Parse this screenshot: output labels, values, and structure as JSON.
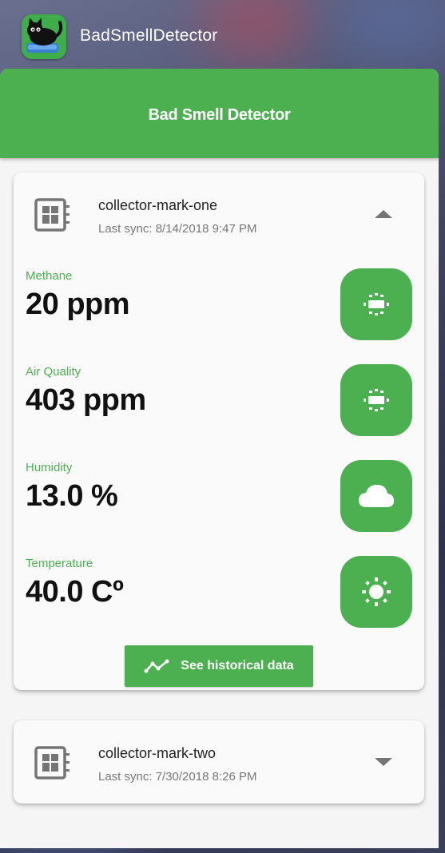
{
  "app": {
    "name": "BadSmellDetector"
  },
  "toolbar": {
    "title": "Bad Smell Detector"
  },
  "devices": [
    {
      "name": "collector-mark-one",
      "last_sync": "Last sync: 8/14/2018 9:47 PM",
      "expanded": true,
      "toggle_icon": "chevron-up-icon",
      "readings": [
        {
          "label": "Methane",
          "value": "20 ppm",
          "icon": "gas-sensor-icon"
        },
        {
          "label": "Air Quality",
          "value": "403 ppm",
          "icon": "gas-sensor-icon"
        },
        {
          "label": "Humidity",
          "value": "13.0 %",
          "icon": "cloud-icon"
        },
        {
          "label": "Temperature",
          "value": "40.0 Cº",
          "icon": "sun-icon"
        }
      ],
      "history_button": {
        "label": "See historical data",
        "icon": "chart-line-icon"
      }
    },
    {
      "name": "collector-mark-two",
      "last_sync": "Last sync: 7/30/2018 8:26 PM",
      "expanded": false,
      "toggle_icon": "chevron-down-icon"
    }
  ],
  "colors": {
    "accent": "#4caf50",
    "card": "#fafafa",
    "background": "#f5f5f5",
    "text": "#111111",
    "muted": "#777777"
  }
}
